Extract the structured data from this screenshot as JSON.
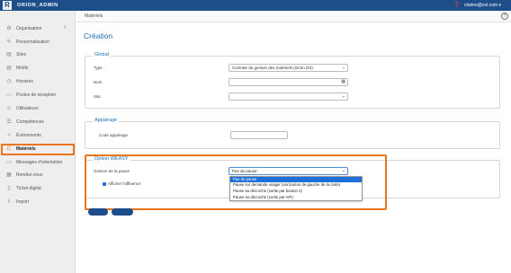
{
  "topbar": {
    "logo": "R",
    "brand": "ORION_ADMIN",
    "help_icon": "help-icon",
    "user": "ctalmo@ovl.com ▾"
  },
  "sidebar": {
    "collapse": "‹",
    "items": [
      {
        "label": "Organisation",
        "icon": "⚙"
      },
      {
        "label": "Personnalisation",
        "icon": "✎"
      },
      {
        "label": "Sites",
        "icon": "▤"
      },
      {
        "label": "Motifs",
        "icon": "▤"
      },
      {
        "label": "Horaires",
        "icon": "◷"
      },
      {
        "label": "Postes de réception",
        "icon": "▭"
      },
      {
        "label": "Utilisateurs",
        "icon": "☺"
      },
      {
        "label": "Compétences",
        "icon": "☰"
      },
      {
        "label": "Événements",
        "icon": "✧"
      },
      {
        "label": "Matériels",
        "icon": "⊏"
      },
      {
        "label": "Messages d'orientation",
        "icon": "▭"
      },
      {
        "label": "Rendez-vous",
        "icon": "▦"
      },
      {
        "label": "Ticket digital",
        "icon": "▯"
      },
      {
        "label": "Import",
        "icon": "⇩"
      }
    ],
    "active": "Matériels"
  },
  "breadcrumb": "Matériels",
  "help": "?",
  "page_title": "Création",
  "global": {
    "title": "Global",
    "type_label": "Type",
    "type_value": "Centrale de gestion des matériels (Orion DX)",
    "nom_label": "Nom",
    "nom_value": "",
    "site_label": "Site",
    "site_value": ""
  },
  "appairage": {
    "title": "Appairage",
    "code_label": "Code appairage",
    "code_value": ""
  },
  "weasy": {
    "title": "Option WEASY",
    "pause_label": "Gestion de la pause",
    "pause_value": "Pas de pause",
    "affluence_label": "Afficher l'affluence",
    "options": [
      "Pas de pause",
      "Pause sur demande usager (via bouton de gauche de la carte)",
      "Pause au décroché (sortie par bouton 2)",
      "Pause au décroché (sortie par API)"
    ]
  },
  "colors": {
    "brand": "#1d4e89",
    "accent": "#1d6fb8",
    "highlight": "#e8761e"
  }
}
